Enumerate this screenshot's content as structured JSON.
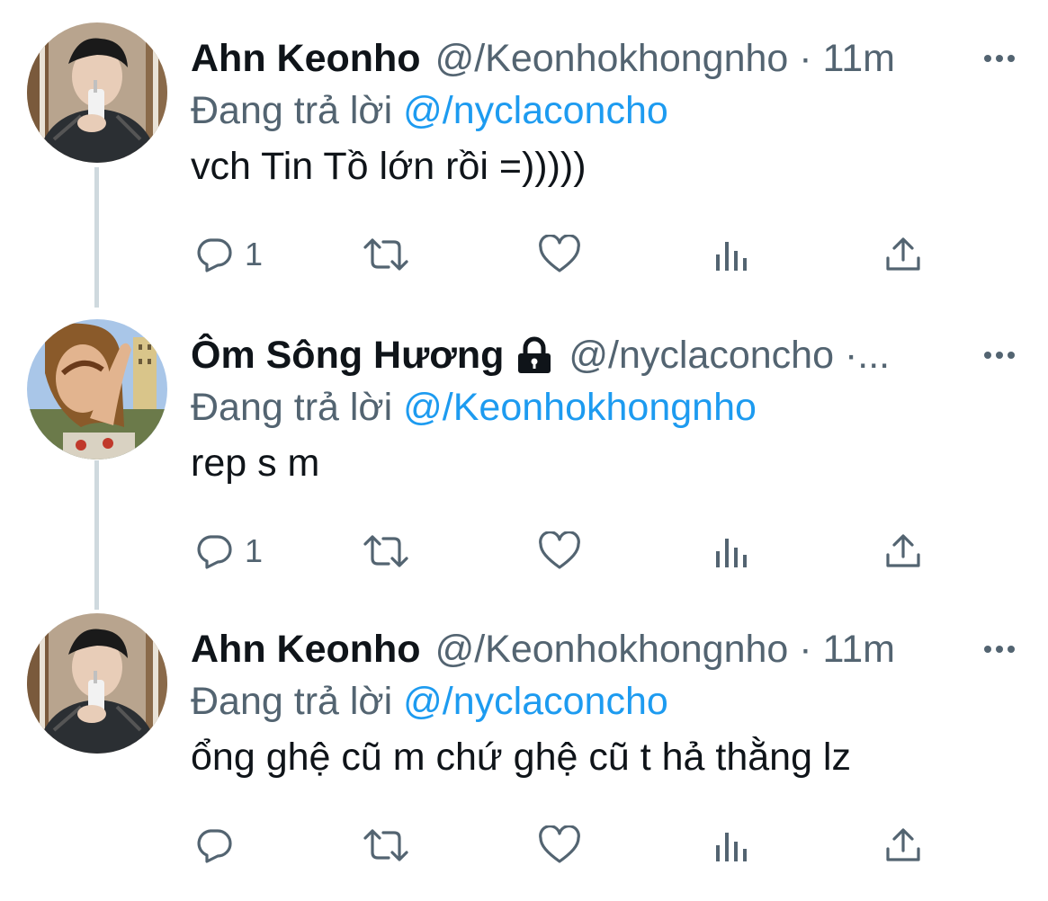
{
  "tweets": [
    {
      "name": "Ahn Keonho",
      "locked": false,
      "meta": "@/Keonhokhongnho · 11m",
      "reply_prefix": "Đang trả lời",
      "reply_handle": "@/nyclaconcho",
      "text": "vch Tin Tồ lớn rồi =)))))",
      "reply_count": "1"
    },
    {
      "name": "Ôm Sông Hương",
      "locked": true,
      "meta": "@/nyclaconcho ·...",
      "reply_prefix": "Đang trả lời",
      "reply_handle": "@/Keonhokhongnho",
      "text": "rep s m",
      "reply_count": "1"
    },
    {
      "name": "Ahn Keonho",
      "locked": false,
      "meta": "@/Keonhokhongnho · 11m",
      "reply_prefix": "Đang trả lời",
      "reply_handle": "@/nyclaconcho",
      "text": "ổng ghệ cũ m chứ ghệ cũ t hả thằng lz",
      "reply_count": ""
    }
  ],
  "icons": {
    "reply": "reply-icon",
    "retweet": "retweet-icon",
    "like": "heart-icon",
    "analytics": "analytics-icon",
    "share": "share-icon",
    "more": "more-icon",
    "lock": "lock-icon"
  },
  "colors": {
    "text": "#0f1419",
    "secondary": "#536471",
    "link": "#1d9bf0",
    "thread_line": "#cfd9de"
  }
}
